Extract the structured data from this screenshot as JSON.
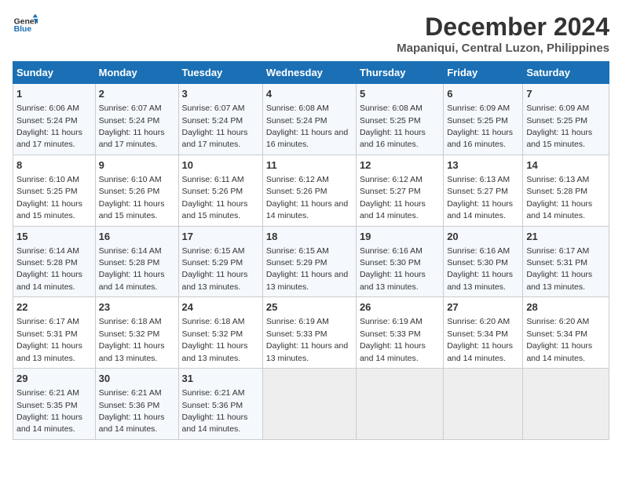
{
  "logo": {
    "line1": "General",
    "line2": "Blue"
  },
  "title": "December 2024",
  "subtitle": "Mapaniqui, Central Luzon, Philippines",
  "days_of_week": [
    "Sunday",
    "Monday",
    "Tuesday",
    "Wednesday",
    "Thursday",
    "Friday",
    "Saturday"
  ],
  "weeks": [
    [
      {
        "day": "1",
        "sunrise": "6:06 AM",
        "sunset": "5:24 PM",
        "daylight": "11 hours and 17 minutes."
      },
      {
        "day": "2",
        "sunrise": "6:07 AM",
        "sunset": "5:24 PM",
        "daylight": "11 hours and 17 minutes."
      },
      {
        "day": "3",
        "sunrise": "6:07 AM",
        "sunset": "5:24 PM",
        "daylight": "11 hours and 17 minutes."
      },
      {
        "day": "4",
        "sunrise": "6:08 AM",
        "sunset": "5:24 PM",
        "daylight": "11 hours and 16 minutes."
      },
      {
        "day": "5",
        "sunrise": "6:08 AM",
        "sunset": "5:25 PM",
        "daylight": "11 hours and 16 minutes."
      },
      {
        "day": "6",
        "sunrise": "6:09 AM",
        "sunset": "5:25 PM",
        "daylight": "11 hours and 16 minutes."
      },
      {
        "day": "7",
        "sunrise": "6:09 AM",
        "sunset": "5:25 PM",
        "daylight": "11 hours and 15 minutes."
      }
    ],
    [
      {
        "day": "8",
        "sunrise": "6:10 AM",
        "sunset": "5:25 PM",
        "daylight": "11 hours and 15 minutes."
      },
      {
        "day": "9",
        "sunrise": "6:10 AM",
        "sunset": "5:26 PM",
        "daylight": "11 hours and 15 minutes."
      },
      {
        "day": "10",
        "sunrise": "6:11 AM",
        "sunset": "5:26 PM",
        "daylight": "11 hours and 15 minutes."
      },
      {
        "day": "11",
        "sunrise": "6:12 AM",
        "sunset": "5:26 PM",
        "daylight": "11 hours and 14 minutes."
      },
      {
        "day": "12",
        "sunrise": "6:12 AM",
        "sunset": "5:27 PM",
        "daylight": "11 hours and 14 minutes."
      },
      {
        "day": "13",
        "sunrise": "6:13 AM",
        "sunset": "5:27 PM",
        "daylight": "11 hours and 14 minutes."
      },
      {
        "day": "14",
        "sunrise": "6:13 AM",
        "sunset": "5:28 PM",
        "daylight": "11 hours and 14 minutes."
      }
    ],
    [
      {
        "day": "15",
        "sunrise": "6:14 AM",
        "sunset": "5:28 PM",
        "daylight": "11 hours and 14 minutes."
      },
      {
        "day": "16",
        "sunrise": "6:14 AM",
        "sunset": "5:28 PM",
        "daylight": "11 hours and 14 minutes."
      },
      {
        "day": "17",
        "sunrise": "6:15 AM",
        "sunset": "5:29 PM",
        "daylight": "11 hours and 13 minutes."
      },
      {
        "day": "18",
        "sunrise": "6:15 AM",
        "sunset": "5:29 PM",
        "daylight": "11 hours and 13 minutes."
      },
      {
        "day": "19",
        "sunrise": "6:16 AM",
        "sunset": "5:30 PM",
        "daylight": "11 hours and 13 minutes."
      },
      {
        "day": "20",
        "sunrise": "6:16 AM",
        "sunset": "5:30 PM",
        "daylight": "11 hours and 13 minutes."
      },
      {
        "day": "21",
        "sunrise": "6:17 AM",
        "sunset": "5:31 PM",
        "daylight": "11 hours and 13 minutes."
      }
    ],
    [
      {
        "day": "22",
        "sunrise": "6:17 AM",
        "sunset": "5:31 PM",
        "daylight": "11 hours and 13 minutes."
      },
      {
        "day": "23",
        "sunrise": "6:18 AM",
        "sunset": "5:32 PM",
        "daylight": "11 hours and 13 minutes."
      },
      {
        "day": "24",
        "sunrise": "6:18 AM",
        "sunset": "5:32 PM",
        "daylight": "11 hours and 13 minutes."
      },
      {
        "day": "25",
        "sunrise": "6:19 AM",
        "sunset": "5:33 PM",
        "daylight": "11 hours and 13 minutes."
      },
      {
        "day": "26",
        "sunrise": "6:19 AM",
        "sunset": "5:33 PM",
        "daylight": "11 hours and 14 minutes."
      },
      {
        "day": "27",
        "sunrise": "6:20 AM",
        "sunset": "5:34 PM",
        "daylight": "11 hours and 14 minutes."
      },
      {
        "day": "28",
        "sunrise": "6:20 AM",
        "sunset": "5:34 PM",
        "daylight": "11 hours and 14 minutes."
      }
    ],
    [
      {
        "day": "29",
        "sunrise": "6:21 AM",
        "sunset": "5:35 PM",
        "daylight": "11 hours and 14 minutes."
      },
      {
        "day": "30",
        "sunrise": "6:21 AM",
        "sunset": "5:36 PM",
        "daylight": "11 hours and 14 minutes."
      },
      {
        "day": "31",
        "sunrise": "6:21 AM",
        "sunset": "5:36 PM",
        "daylight": "11 hours and 14 minutes."
      },
      null,
      null,
      null,
      null
    ]
  ]
}
